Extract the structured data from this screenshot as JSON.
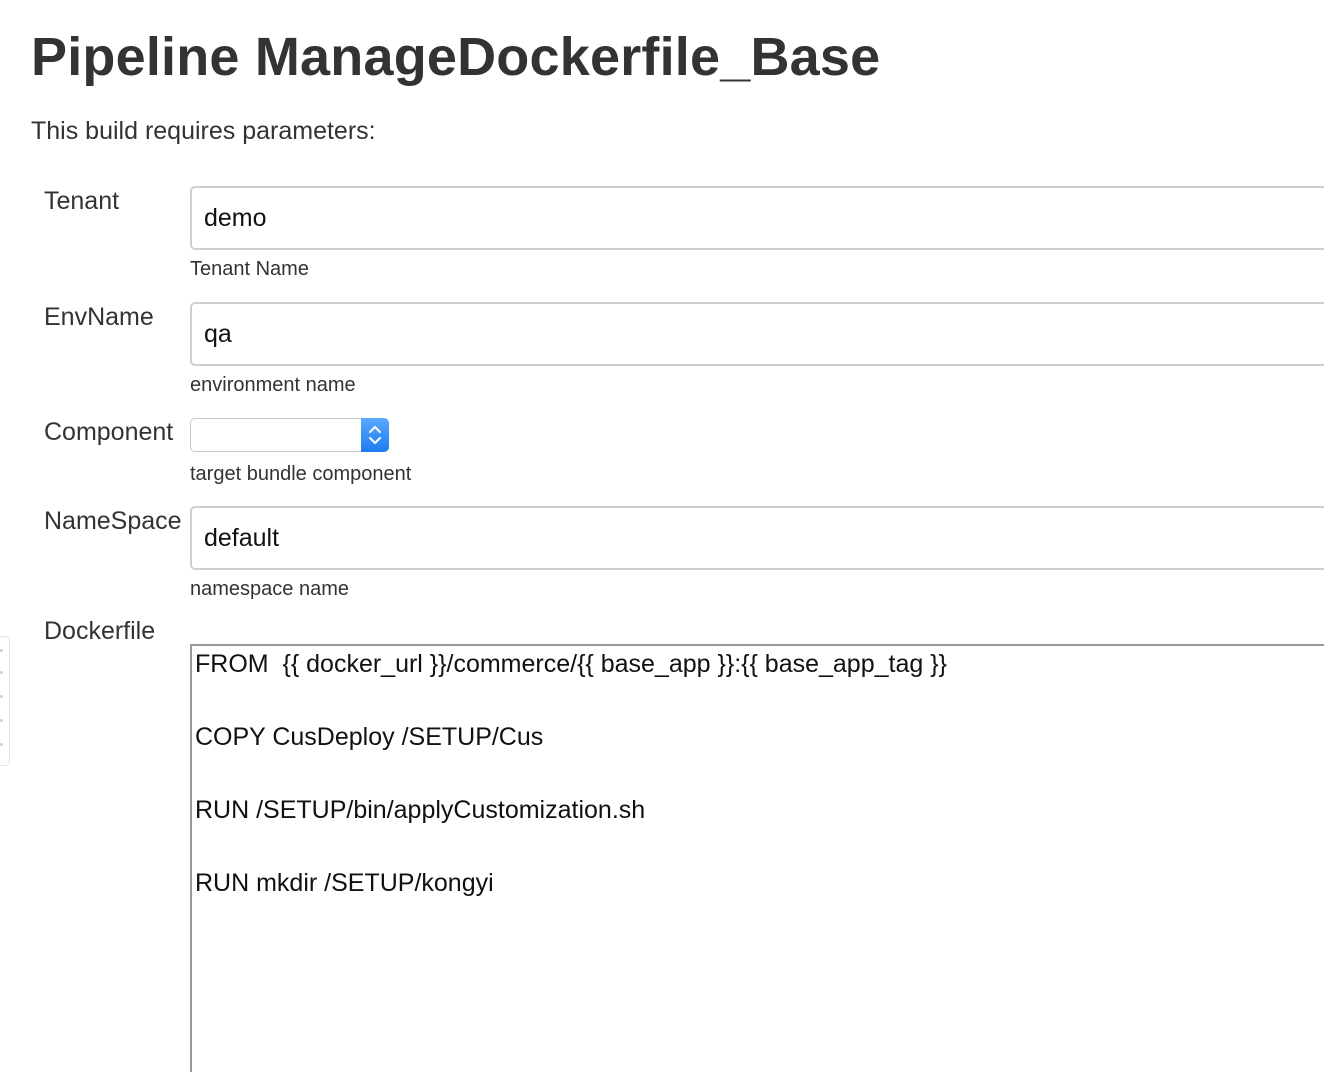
{
  "page": {
    "title": "Pipeline ManageDockerfile_Base",
    "intro": "This build requires parameters:"
  },
  "params": {
    "tenant": {
      "label": "Tenant",
      "value": "demo",
      "description": "Tenant Name"
    },
    "envname": {
      "label": "EnvName",
      "value": "qa",
      "description": "environment name"
    },
    "component": {
      "label": "Component",
      "selected": "",
      "description": "target bundle component"
    },
    "namespace": {
      "label": "NameSpace",
      "value": "default",
      "description": "namespace name"
    },
    "dockerfile": {
      "label": "Dockerfile",
      "content": "FROM  {{ docker_url }}/commerce/{{ base_app }}:{{ base_app_tag }}\n\nCOPY CusDeploy /SETUP/Cus\n\nRUN /SETUP/bin/applyCustomization.sh\n\nRUN mkdir /SETUP/kongyi"
    }
  },
  "icons": {
    "select_stepper": "up-down-chevron-icon",
    "side_tab": "grip-dots-icon"
  },
  "colors": {
    "stepper_accent": "#1e7cf0",
    "text": "#333333"
  }
}
